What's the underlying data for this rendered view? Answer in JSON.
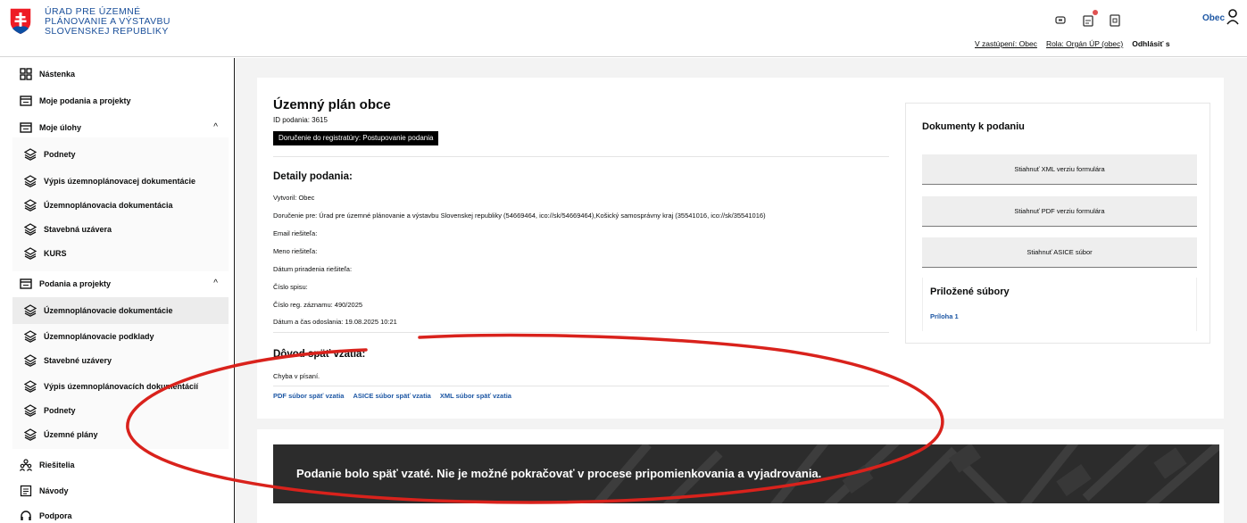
{
  "header": {
    "logo_lines": [
      "ÚRAD PRE ÚZEMNÉ",
      "PLÁNOVANIE A VÝSTAVBU",
      "SLOVENSKEJ REPUBLIKY"
    ],
    "icons": [
      "chat-icon",
      "notification-icon",
      "document-icon"
    ],
    "user_label": "Obec",
    "links": {
      "representation": "V zastúpení: Obec",
      "role": "Rola: Orgán ÚP (obec)",
      "logout": "Odhlásiť s"
    }
  },
  "sidebar": {
    "items": [
      {
        "label": "Nástenka",
        "icon": "dashboard-icon"
      },
      {
        "label": "Moje podania a projekty",
        "icon": "folder-icon"
      },
      {
        "label": "Moje úlohy",
        "icon": "folder-icon",
        "expanded": true
      },
      {
        "label": "Podnety",
        "icon": "layers-icon"
      },
      {
        "label": "Výpis územnoplánovacej dokumentácie",
        "icon": "layers-icon"
      },
      {
        "label": "Územnoplánovacia dokumentácia",
        "icon": "layers-icon"
      },
      {
        "label": "Stavebná uzávera",
        "icon": "layers-icon"
      },
      {
        "label": "KURS",
        "icon": "layers-icon"
      },
      {
        "label": "Podania a projekty",
        "icon": "folder-icon",
        "expanded": true
      },
      {
        "label": "Územnoplánovacie dokumentácie",
        "icon": "layers-icon",
        "selected": true
      },
      {
        "label": "Územnoplánovacie podklady",
        "icon": "layers-icon"
      },
      {
        "label": "Stavebné uzávery",
        "icon": "layers-icon"
      },
      {
        "label": "Výpis územnoplánovacích dokumentácií",
        "icon": "layers-icon"
      },
      {
        "label": "Podnety",
        "icon": "layers-icon"
      },
      {
        "label": "Územné plány",
        "icon": "layers-icon"
      },
      {
        "label": "Riešitelia",
        "icon": "people-icon"
      },
      {
        "label": "Návody",
        "icon": "guide-icon"
      },
      {
        "label": "Podpora",
        "icon": "headset-icon"
      }
    ]
  },
  "main": {
    "title": "Územný plán obce",
    "id_line": "ID podania: 3615",
    "status_badge": "Doručenie do registratúry: Postupovanie podania",
    "details_title": "Detaily podania:",
    "details": [
      "Vytvoril: Obec",
      "Doručenie pre: Úrad pre územné plánovanie a výstavbu Slovenskej republiky (54669464, ico://sk/54669464),Košický samosprávny kraj (35541016, ico://sk/35541016)",
      "Email riešiteľa:",
      "Meno riešiteľa:",
      "Dátum priradenia riešiteľa:",
      "Číslo spisu:",
      "Číslo reg. záznamu: 490/2025",
      "Dátum a čas odoslania: 19.08.2025 10:21"
    ],
    "withdrawal_title": "Dôvod späť vzatia:",
    "withdrawal_reason": "Chyba v písaní.",
    "withdrawal_links": [
      "PDF súbor späť vzatia",
      "ASICE súbor späť vzatia",
      "XML súbor späť vzatia"
    ],
    "documents": {
      "title": "Dokumenty k podaniu",
      "buttons": [
        "Stiahnuť XML verziu formulára",
        "Stiahnuť PDF verziu formulára",
        "Stiahnuť ASICE súbor"
      ],
      "attachments_title": "Priložené súbory",
      "attachments": [
        "Príloha 1"
      ]
    },
    "banner_text": "Podanie bolo späť vzaté. Nie je možné pokračovať v procese pripomienkovania a vyjadrovania."
  },
  "colors": {
    "link": "#1d57a4",
    "annotation": "#d9221c",
    "banner": "#2c2c2c"
  }
}
